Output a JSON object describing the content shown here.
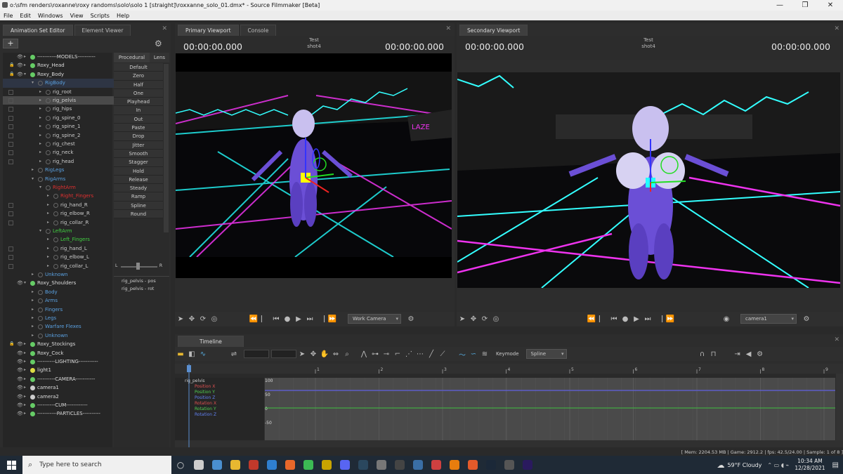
{
  "window": {
    "title": "o:\\sfm renders\\roxanne\\roxy randoms\\solo\\solo 1 [straight]\\roxxanne_solo_01.dmx* - Source Filmmaker [Beta]"
  },
  "menu": [
    "File",
    "Edit",
    "Windows",
    "View",
    "Scripts",
    "Help"
  ],
  "left_panel": {
    "tabs": [
      "Animation Set Editor",
      "Element Viewer"
    ],
    "tree": [
      {
        "label": "-----------MODELS----------",
        "indent": 0,
        "color": "#dcdcdc",
        "eye": true,
        "nd": "#6c6"
      },
      {
        "label": "Roxy_Head",
        "indent": 0,
        "color": "#dcdcdc",
        "eye": true,
        "lock": true,
        "nd": "#6c6"
      },
      {
        "label": "Roxy_Body",
        "indent": 0,
        "color": "#dcdcdc",
        "eye": true,
        "lock": true,
        "nd": "#6c6",
        "open": true
      },
      {
        "label": "RigBody",
        "indent": 1,
        "color": "#5aa0e0",
        "sel": true,
        "open": true
      },
      {
        "label": "rig_root",
        "indent": 2,
        "color": "#ccc",
        "cb": true
      },
      {
        "label": "rig_pelvis",
        "indent": 2,
        "color": "#ccc",
        "cb": true,
        "hl": true
      },
      {
        "label": "rig_hips",
        "indent": 2,
        "color": "#ccc",
        "cb": true
      },
      {
        "label": "rig_spine_0",
        "indent": 2,
        "color": "#ccc",
        "cb": true
      },
      {
        "label": "rig_spine_1",
        "indent": 2,
        "color": "#ccc",
        "cb": true
      },
      {
        "label": "rig_spine_2",
        "indent": 2,
        "color": "#ccc",
        "cb": true
      },
      {
        "label": "rig_chest",
        "indent": 2,
        "color": "#ccc",
        "cb": true
      },
      {
        "label": "rig_neck",
        "indent": 2,
        "color": "#ccc",
        "cb": true
      },
      {
        "label": "rig_head",
        "indent": 2,
        "color": "#ccc",
        "cb": true
      },
      {
        "label": "RigLegs",
        "indent": 1,
        "color": "#5aa0e0"
      },
      {
        "label": "RigArms",
        "indent": 1,
        "color": "#5aa0e0",
        "open": true
      },
      {
        "label": "RightArm",
        "indent": 2,
        "color": "#e03030",
        "open": true
      },
      {
        "label": "Right_Fingers",
        "indent": 3,
        "color": "#e03030"
      },
      {
        "label": "rig_hand_R",
        "indent": 3,
        "color": "#ccc",
        "cb": true
      },
      {
        "label": "rig_elbow_R",
        "indent": 3,
        "color": "#ccc",
        "cb": true
      },
      {
        "label": "rig_collar_R",
        "indent": 3,
        "color": "#ccc",
        "cb": true
      },
      {
        "label": "LeftArm",
        "indent": 2,
        "color": "#40d040",
        "open": true
      },
      {
        "label": "Left_Fingers",
        "indent": 3,
        "color": "#40d040"
      },
      {
        "label": "rig_hand_L",
        "indent": 3,
        "color": "#ccc",
        "cb": true
      },
      {
        "label": "rig_elbow_L",
        "indent": 3,
        "color": "#ccc",
        "cb": true
      },
      {
        "label": "rig_collar_L",
        "indent": 3,
        "color": "#ccc",
        "cb": true
      },
      {
        "label": "Unknown",
        "indent": 1,
        "color": "#5aa0e0"
      },
      {
        "label": "Roxy_Shoulders",
        "indent": 0,
        "color": "#dcdcdc",
        "eye": true,
        "nd": "#6c6",
        "open": true
      },
      {
        "label": "Body",
        "indent": 1,
        "color": "#5aa0e0"
      },
      {
        "label": "Arms",
        "indent": 1,
        "color": "#5aa0e0"
      },
      {
        "label": "Fingers",
        "indent": 1,
        "color": "#5aa0e0"
      },
      {
        "label": "Legs",
        "indent": 1,
        "color": "#5aa0e0"
      },
      {
        "label": "Warfare Flexes",
        "indent": 1,
        "color": "#5aa0e0"
      },
      {
        "label": "Unknown",
        "indent": 1,
        "color": "#5aa0e0"
      },
      {
        "label": "Roxy_Stockings",
        "indent": 0,
        "color": "#dcdcdc",
        "eye": true,
        "lock": true,
        "nd": "#6c6"
      },
      {
        "label": "Roxy_Cock",
        "indent": 0,
        "color": "#dcdcdc",
        "eye": true,
        "nd": "#6c6"
      },
      {
        "label": "----------LIGHTING-----------",
        "indent": 0,
        "color": "#dcdcdc",
        "eye": true,
        "nd": "#6c6"
      },
      {
        "label": "light1",
        "indent": 0,
        "color": "#dcdcdc",
        "eye": true,
        "nd": "#dd4"
      },
      {
        "label": "----------CAMERA-----------",
        "indent": 0,
        "color": "#dcdcdc",
        "eye": true,
        "nd": "#6c6"
      },
      {
        "label": "camera1",
        "indent": 0,
        "color": "#dcdcdc",
        "eye": true,
        "nd": "#ccc"
      },
      {
        "label": "camera2",
        "indent": 0,
        "color": "#dcdcdc",
        "eye": true,
        "nd": "#ccc"
      },
      {
        "label": "----------CUM------------",
        "indent": 0,
        "color": "#dcdcdc",
        "eye": true,
        "nd": "#6c6"
      },
      {
        "label": "-----------PARTICLES----------",
        "indent": 0,
        "color": "#dcdcdc",
        "eye": true,
        "nd": "#6c6"
      }
    ],
    "procedural_tabs": [
      "Procedural",
      "Lens"
    ],
    "presets": [
      "Default",
      "Zero",
      "Half",
      "One",
      "Playhead",
      "In",
      "Out",
      "Paste",
      "Drop",
      "Jitter",
      "Smooth",
      "Stagger",
      "Hold",
      "Release",
      "Steady",
      "Ramp",
      "Spline",
      "Round"
    ],
    "balance_left": "L",
    "balance_right": "R",
    "controls": [
      "rig_pelvis - pos",
      "rig_pelvis - rot"
    ]
  },
  "primary": {
    "tabs": [
      "Primary Viewport",
      "Console"
    ],
    "tc_left": "00:00:00.000",
    "tc_right": "00:00:00.000",
    "center_top": "Test",
    "center_bottom": "shot4",
    "camera": "Work Camera"
  },
  "secondary": {
    "tabs": [
      "Secondary Viewport"
    ],
    "tc_left": "00:00:00.000",
    "tc_right": "00:00:00.000",
    "center_top": "Test",
    "center_bottom": "shot4",
    "camera": "camera1"
  },
  "timeline": {
    "tab": "Timeline",
    "keymode_label": "Keymode",
    "keymode_value": "Spline",
    "ticks": [
      "1",
      "2",
      "3",
      "4",
      "5",
      "6",
      "7",
      "8",
      "9",
      "10"
    ],
    "channel_root": "rig_pelvis",
    "channels": [
      {
        "name": "Position X",
        "color": "#e05050"
      },
      {
        "name": "Position Y",
        "color": "#50d050"
      },
      {
        "name": "Position Z",
        "color": "#6080f0"
      },
      {
        "name": "Rotation X",
        "color": "#e05050"
      },
      {
        "name": "Rotation Y",
        "color": "#50d050"
      },
      {
        "name": "Rotation Z",
        "color": "#6080f0"
      }
    ],
    "yaxis": [
      "100",
      "50",
      "0",
      "-50"
    ],
    "status": "[ Mem: 2204.53 MB | Game:    2912.2 | fps:     42.5/24.00 | Sample:      1 of 8 ]"
  },
  "taskbar": {
    "search_placeholder": "Type here to search",
    "weather": "59°F  Cloudy",
    "time": "10:34 AM",
    "date": "12/28/2021",
    "icons": [
      {
        "name": "task-view",
        "color": "#ccc"
      },
      {
        "name": "calculator",
        "color": "#4a8fd0"
      },
      {
        "name": "file-explorer",
        "color": "#e8b830"
      },
      {
        "name": "app-red",
        "color": "#c0392b"
      },
      {
        "name": "mail",
        "color": "#2f7fd0"
      },
      {
        "name": "firefox",
        "color": "#e8672a"
      },
      {
        "name": "chrome",
        "color": "#3cba54"
      },
      {
        "name": "world-of-warcraft",
        "color": "#c9a400"
      },
      {
        "name": "discord",
        "color": "#5865f2"
      },
      {
        "name": "steam",
        "color": "#2a475e"
      },
      {
        "name": "app-box",
        "color": "#777"
      },
      {
        "name": "obs",
        "color": "#444"
      },
      {
        "name": "app-game",
        "color": "#3a6ea5"
      },
      {
        "name": "app-alert",
        "color": "#d04040"
      },
      {
        "name": "blender",
        "color": "#e87d0d"
      },
      {
        "name": "app-orange",
        "color": "#e45a2a"
      },
      {
        "name": "steam-active",
        "color": "#1b2838"
      },
      {
        "name": "sfm",
        "color": "#555"
      },
      {
        "name": "premiere",
        "color": "#2a1a5e"
      }
    ]
  }
}
